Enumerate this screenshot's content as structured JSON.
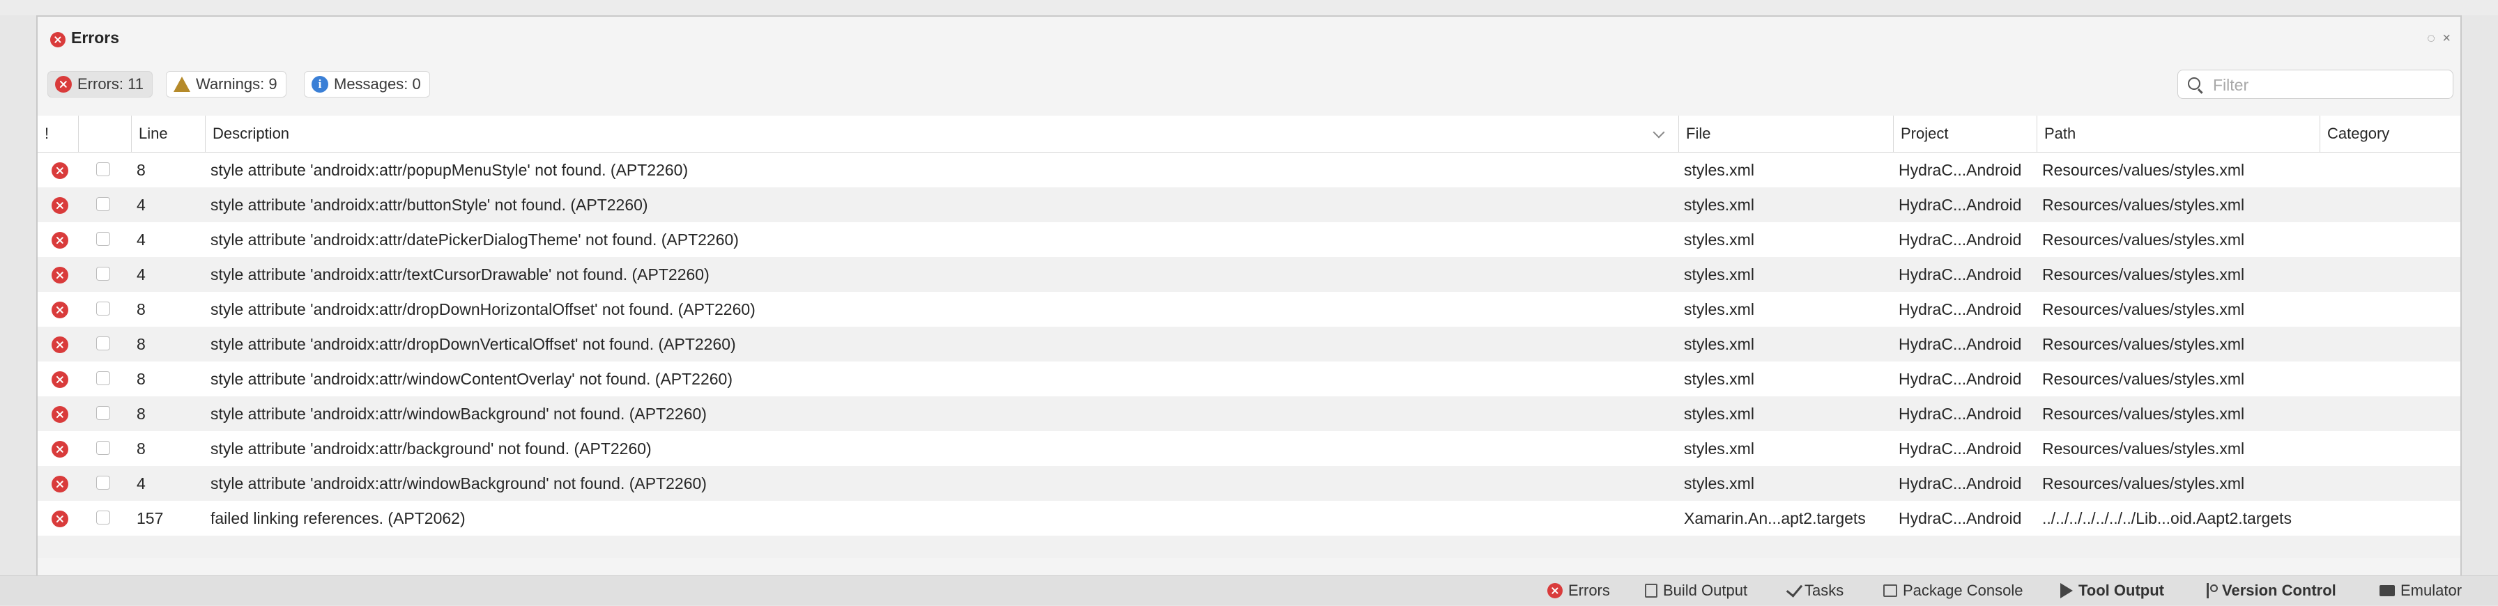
{
  "pad": {
    "title": "Errors",
    "filters": {
      "errors_label": "Errors: 11",
      "warnings_label": "Warnings: 9",
      "messages_label": "Messages: 0"
    },
    "search": {
      "placeholder": "Filter"
    }
  },
  "table": {
    "columns": {
      "bang": "!",
      "line": "Line",
      "description": "Description",
      "file": "File",
      "project": "Project",
      "path": "Path",
      "category": "Category"
    },
    "rows": [
      {
        "line": "8",
        "description": "style attribute 'androidx:attr/popupMenuStyle' not found. (APT2260)",
        "file": "styles.xml",
        "project": "HydraC...Android",
        "path": "Resources/values/styles.xml"
      },
      {
        "line": "4",
        "description": "style attribute 'androidx:attr/buttonStyle' not found. (APT2260)",
        "file": "styles.xml",
        "project": "HydraC...Android",
        "path": "Resources/values/styles.xml"
      },
      {
        "line": "4",
        "description": "style attribute 'androidx:attr/datePickerDialogTheme' not found. (APT2260)",
        "file": "styles.xml",
        "project": "HydraC...Android",
        "path": "Resources/values/styles.xml"
      },
      {
        "line": "4",
        "description": "style attribute 'androidx:attr/textCursorDrawable' not found. (APT2260)",
        "file": "styles.xml",
        "project": "HydraC...Android",
        "path": "Resources/values/styles.xml"
      },
      {
        "line": "8",
        "description": "style attribute 'androidx:attr/dropDownHorizontalOffset' not found. (APT2260)",
        "file": "styles.xml",
        "project": "HydraC...Android",
        "path": "Resources/values/styles.xml"
      },
      {
        "line": "8",
        "description": "style attribute 'androidx:attr/dropDownVerticalOffset' not found. (APT2260)",
        "file": "styles.xml",
        "project": "HydraC...Android",
        "path": "Resources/values/styles.xml"
      },
      {
        "line": "8",
        "description": "style attribute 'androidx:attr/windowContentOverlay' not found. (APT2260)",
        "file": "styles.xml",
        "project": "HydraC...Android",
        "path": "Resources/values/styles.xml"
      },
      {
        "line": "8",
        "description": "style attribute 'androidx:attr/windowBackground' not found. (APT2260)",
        "file": "styles.xml",
        "project": "HydraC...Android",
        "path": "Resources/values/styles.xml"
      },
      {
        "line": "8",
        "description": "style attribute 'androidx:attr/background' not found. (APT2260)",
        "file": "styles.xml",
        "project": "HydraC...Android",
        "path": "Resources/values/styles.xml"
      },
      {
        "line": "4",
        "description": "style attribute 'androidx:attr/windowBackground' not found. (APT2260)",
        "file": "styles.xml",
        "project": "HydraC...Android",
        "path": "Resources/values/styles.xml"
      },
      {
        "line": "157",
        "description": "failed linking references. (APT2062)",
        "file": "Xamarin.An...apt2.targets",
        "project": "HydraC...Android",
        "path": "../../../../../../../Lib...oid.Aapt2.targets"
      }
    ]
  },
  "bottom_tabs": {
    "errors": "Errors",
    "build_output": "Build Output",
    "tasks": "Tasks",
    "package_console": "Package Console",
    "tool_output": "Tool Output",
    "version_control": "Version Control",
    "emulator": "Emulator"
  },
  "icons": {
    "error": "error-circle-icon",
    "warning": "warning-triangle-icon",
    "info": "info-circle-icon",
    "search": "search-icon"
  },
  "colors": {
    "error_red": "#d93b3b",
    "warning_amber": "#b58a2a",
    "info_blue": "#3a7fd6"
  }
}
